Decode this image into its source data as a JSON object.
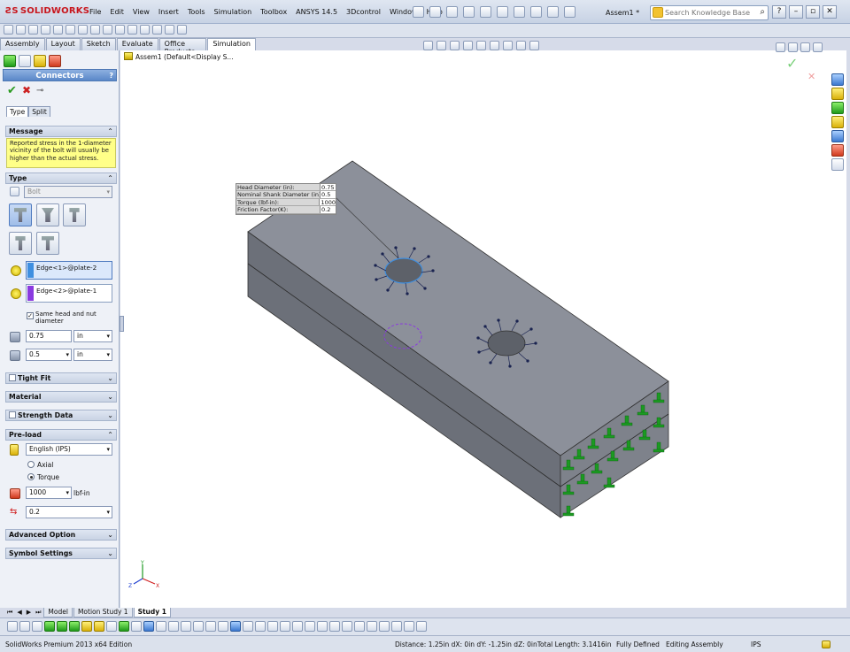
{
  "app": {
    "logo_text": "SOLIDWORKS",
    "document_title": "Assem1 *"
  },
  "menu": {
    "items": [
      "File",
      "Edit",
      "View",
      "Insert",
      "Tools",
      "Simulation",
      "Toolbox",
      "ANSYS 14.5",
      "3Dcontrol",
      "Window",
      "Help"
    ]
  },
  "search": {
    "placeholder": "Search Knowledge Base"
  },
  "cm_tabs": [
    "Assembly",
    "Layout",
    "Sketch",
    "Evaluate",
    "Office Products",
    "Simulation"
  ],
  "panel": {
    "title": "Connectors",
    "help": "?",
    "tabs": [
      "Type",
      "Split"
    ],
    "message": {
      "header": "Message",
      "text": "Reported stress in the 1-diameter vicinity of the bolt will usually be higher than the actual stress."
    },
    "type": {
      "header": "Type",
      "selected": "Bolt",
      "edge1": "Edge<1>@plate-2",
      "edge2": "Edge<2>@plate-1",
      "same_head_label": "Same head and nut diameter",
      "head_diameter": "0.75",
      "head_unit": "in",
      "shank_diameter": "0.5",
      "shank_unit": "in"
    },
    "tight_fit": "Tight Fit",
    "material": "Material",
    "strength_data": "Strength Data",
    "preload": {
      "header": "Pre-load",
      "unit_system": "English (IPS)",
      "axial_label": "Axial",
      "torque_label": "Torque",
      "torque_value": "1000",
      "torque_unit": "lbf-in",
      "friction": "0.2"
    },
    "advanced": "Advanced Option",
    "symbol": "Symbol Settings"
  },
  "tree": {
    "label": "Assem1  (Default<Display S..."
  },
  "callout": {
    "rows": [
      {
        "label": "Head Diameter (in):",
        "value": "0.75"
      },
      {
        "label": "Nominal Shank Diameter (in):",
        "value": "0.5"
      },
      {
        "label": "Torque (lbf-in):",
        "value": "1000"
      },
      {
        "label": "Friction Factor(K):",
        "value": "0.2"
      }
    ]
  },
  "triad": {
    "x": "X",
    "y": "Y",
    "z": "Z"
  },
  "bottom_tabs": [
    "Model",
    "Motion Study 1",
    "Study 1"
  ],
  "status": {
    "edition": "SolidWorks Premium 2013 x64 Edition",
    "distance": "Distance: 1.25in  dX: 0in  dY: -1.25in  dZ: 0inTotal Length: 3.1416in",
    "defined": "Fully Defined",
    "mode": "Editing Assembly",
    "units": "IPS"
  },
  "colors": {
    "model_top": "#8b8f98",
    "model_side": "#6b6f78",
    "fixture_green": "#1c9a22",
    "edge1_bar": "#3f8fe0",
    "edge2_bar": "#8a3ae0"
  }
}
